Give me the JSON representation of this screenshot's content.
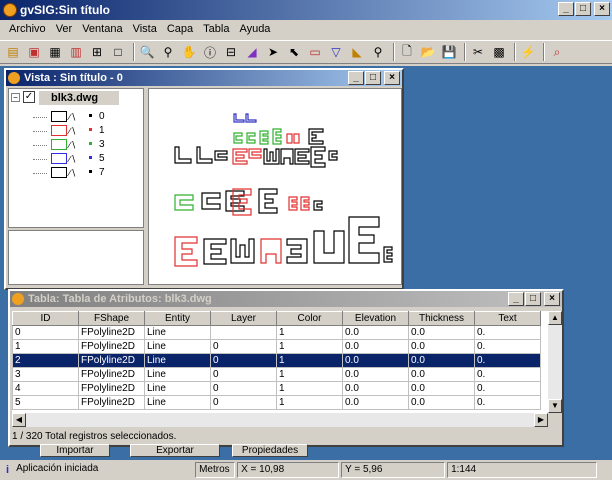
{
  "app": {
    "title": "gvSIG:Sin título"
  },
  "menu": [
    "Archivo",
    "Ver",
    "Ventana",
    "Vista",
    "Capa",
    "Tabla",
    "Ayuda"
  ],
  "view": {
    "title": "Vista : Sin título - 0",
    "layer": "blk3.dwg",
    "sublayers": [
      {
        "label": "0",
        "color": "#000000"
      },
      {
        "label": "1",
        "color": "#e03030"
      },
      {
        "label": "3",
        "color": "#30b030"
      },
      {
        "label": "5",
        "color": "#3030e0"
      },
      {
        "label": "7",
        "color": "#000000"
      }
    ]
  },
  "table": {
    "title": "Tabla: Tabla de Atributos: blk3.dwg",
    "columns": [
      "ID",
      "FShape",
      "Entity",
      "Layer",
      "Color",
      "Elevation",
      "Thickness",
      "Text"
    ],
    "rows": [
      [
        "0",
        "FPolyline2D",
        "Line",
        "",
        "1",
        "0.0",
        "0.0",
        "0."
      ],
      [
        "1",
        "FPolyline2D",
        "Line",
        "0",
        "1",
        "0.0",
        "0.0",
        "0."
      ],
      [
        "2",
        "FPolyline2D",
        "Line",
        "0",
        "1",
        "0.0",
        "0.0",
        "0."
      ],
      [
        "3",
        "FPolyline2D",
        "Line",
        "0",
        "1",
        "0.0",
        "0.0",
        "0."
      ],
      [
        "4",
        "FPolyline2D",
        "Line",
        "0",
        "1",
        "0.0",
        "0.0",
        "0."
      ],
      [
        "5",
        "FPolyline2D",
        "Line",
        "0",
        "1",
        "0.0",
        "0.0",
        "0."
      ]
    ],
    "selected_row": 2,
    "status": "1 / 320 Total registros seleccionados.",
    "buttons": [
      "Importar",
      "Exportar",
      "Propiedades"
    ]
  },
  "status": {
    "message": "Aplicación iniciada",
    "units": "Metros",
    "x": "X = 10,98",
    "y": "Y = 5,96",
    "scale": "1:144"
  }
}
